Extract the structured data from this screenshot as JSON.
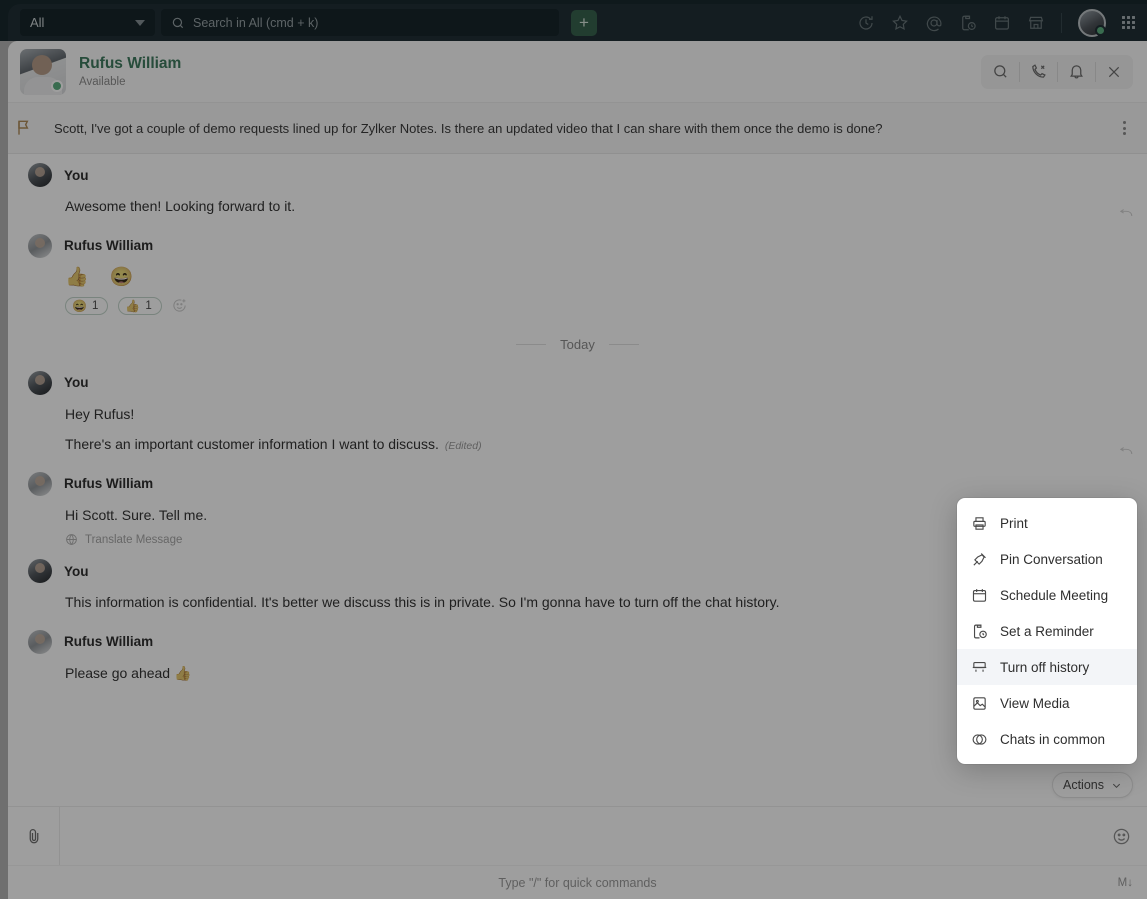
{
  "topbar": {
    "scope_label": "All",
    "scope_caret_icon": "chevron-down-icon",
    "search_placeholder": "Search in All (cmd + k)",
    "search_value": "",
    "search_icon": "search-icon",
    "add_button_label": "+",
    "icons": [
      "history-icon",
      "star-icon",
      "mentions-icon",
      "reminder-icon",
      "calendar-icon",
      "marketplace-icon"
    ],
    "avatar_name": "user-avatar",
    "app_grid_icon": "apps-grid-icon"
  },
  "chat_header": {
    "contact_name": "Rufus William",
    "status_text": "Available",
    "avatar_name": "contact-avatar",
    "actions": [
      {
        "name": "search-in-chat",
        "icon": "search-icon"
      },
      {
        "name": "call",
        "icon": "phone-icon"
      },
      {
        "name": "notifications",
        "icon": "bell-icon"
      },
      {
        "name": "close-chat",
        "icon": "close-icon"
      }
    ]
  },
  "pinned": {
    "icon": "pin-flag-icon",
    "text": "Scott, I've got a couple of demo requests lined up for Zylker Notes. Is there an updated video that I can share with them once the demo is done?",
    "more_icon": "more-vertical-icon"
  },
  "messages": [
    {
      "sender": "You",
      "avatar": "you-avatar",
      "lines": [
        "Awesome then! Looking forward to it."
      ],
      "edited": "",
      "emojis": "",
      "reactions": [],
      "translate": ""
    },
    {
      "sender": "Rufus William",
      "avatar": "rufus-avatar",
      "lines": [],
      "edited": "",
      "emojis": "👍 😄",
      "reactions": [
        {
          "emoji": "😄",
          "count": "1"
        },
        {
          "emoji": "👍",
          "count": "1"
        }
      ],
      "translate": ""
    }
  ],
  "day_divider": "Today",
  "messages_today": [
    {
      "sender": "You",
      "avatar": "you-avatar",
      "lines": [
        "Hey Rufus!",
        "There's an important customer information I want to discuss."
      ],
      "edited": "(Edited)",
      "translate": ""
    },
    {
      "sender": "Rufus William",
      "avatar": "rufus-avatar",
      "lines": [
        "Hi Scott. Sure. Tell me."
      ],
      "edited": "",
      "translate": "Translate Message"
    },
    {
      "sender": "You",
      "avatar": "you-avatar",
      "lines": [
        "This information is confidential. It's better we discuss this is in private. So I'm gonna have to turn off the chat history."
      ],
      "edited": "",
      "translate": ""
    },
    {
      "sender": "Rufus William",
      "avatar": "rufus-avatar",
      "lines": [
        "Please go ahead 👍"
      ],
      "edited": "",
      "translate": ""
    }
  ],
  "actions_pill": {
    "label": "Actions",
    "caret_icon": "chevron-down-icon"
  },
  "context_menu": {
    "items": [
      {
        "label": "Print",
        "icon": "printer-icon",
        "active": false
      },
      {
        "label": "Pin Conversation",
        "icon": "pin-icon",
        "active": false
      },
      {
        "label": "Schedule Meeting",
        "icon": "calendar-icon",
        "active": false
      },
      {
        "label": "Set a Reminder",
        "icon": "reminder-clock-icon",
        "active": false
      },
      {
        "label": "Turn off history",
        "icon": "history-off-icon",
        "active": true
      },
      {
        "label": "View Media",
        "icon": "image-icon",
        "active": false
      },
      {
        "label": "Chats in common",
        "icon": "chats-common-icon",
        "active": false
      }
    ]
  },
  "composer": {
    "attach_icon": "paperclip-icon",
    "input_value": "",
    "input_placeholder": "",
    "emoji_icon": "emoji-smiley-icon",
    "hint": "Type \"/\" for quick commands",
    "markdown_label": "M↓"
  },
  "colors": {
    "topbar_bg": "#15323c",
    "accent_green": "#1a8754",
    "plus_button": "#1c6b45",
    "online_dot": "#2bbf6a",
    "menu_active_bg": "#f3f5f8"
  }
}
